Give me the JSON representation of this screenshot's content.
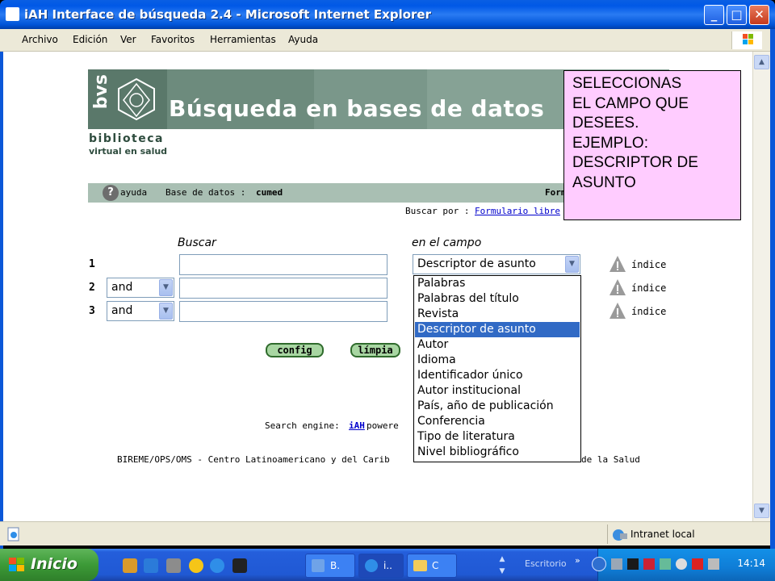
{
  "window": {
    "title": "iAH Interface de búsqueda 2.4 - Microsoft Internet Explorer",
    "buttons": {
      "minimize": "_",
      "maximize": "□",
      "close": "✕"
    }
  },
  "menu": [
    "Archivo",
    "Edición",
    "Ver",
    "Favoritos",
    "Herramientas",
    "Ayuda"
  ],
  "banner": {
    "logo_text": "bvs",
    "title": "Búsqueda en bases de datos",
    "subtitle_line1": "biblioteca",
    "subtitle_line2": "virtual en salud"
  },
  "infobar": {
    "help_label": "ayuda",
    "database_prefix": "Base de datos : ",
    "database_name": "cumed",
    "form_label_truncated": "Form"
  },
  "search_by": {
    "prefix": "Buscar por : ",
    "link": "Formulario libre"
  },
  "form": {
    "buscar_label": "Buscar",
    "campo_label": "en el campo",
    "rows": [
      {
        "num": "1",
        "operator": "",
        "value": "",
        "field": "Descriptor de asunto",
        "index_label": "índice"
      },
      {
        "num": "2",
        "operator": "and",
        "value": "",
        "field": "",
        "index_label": "índice"
      },
      {
        "num": "3",
        "operator": "and",
        "value": "",
        "field": "",
        "index_label": "índice"
      }
    ],
    "config_button": "config",
    "clear_button": "límpia"
  },
  "field_options": [
    "Palabras",
    "Palabras del título",
    "Revista",
    "Descriptor de asunto",
    "Autor",
    "Idioma",
    "Identificador único",
    "Autor institucional",
    "País, año de publicación",
    "Conferencia",
    "Tipo de literatura",
    "Nivel bibliográfico"
  ],
  "selected_option_index": 3,
  "footer": {
    "engine_prefix": "Search engine: ",
    "engine_link": "iAH",
    "engine_suffix": " powere",
    "bireme_left": "BIREME/OPS/OMS - Centro Latinoamericano y del Carib",
    "bireme_right": "de la Salud"
  },
  "note": [
    "SELECCIONAS",
    "EL CAMPO QUE",
    "DESEES.",
    "EJEMPLO:",
    "DESCRIPTOR DE",
    "ASUNTO"
  ],
  "statusbar": {
    "zone": "Intranet local"
  },
  "taskbar": {
    "start": "Inicio",
    "tasks": [
      "B.",
      "i..",
      "C"
    ],
    "escritorio": "Escritorio",
    "clock": "14:14"
  },
  "colors": {
    "banner": "#6d8b7d",
    "infobar": "#a9bfb3",
    "note_bg": "#ffccff",
    "selected_option": "#316ac5",
    "taskbar": "#245edb",
    "start": "#3c9a37"
  }
}
